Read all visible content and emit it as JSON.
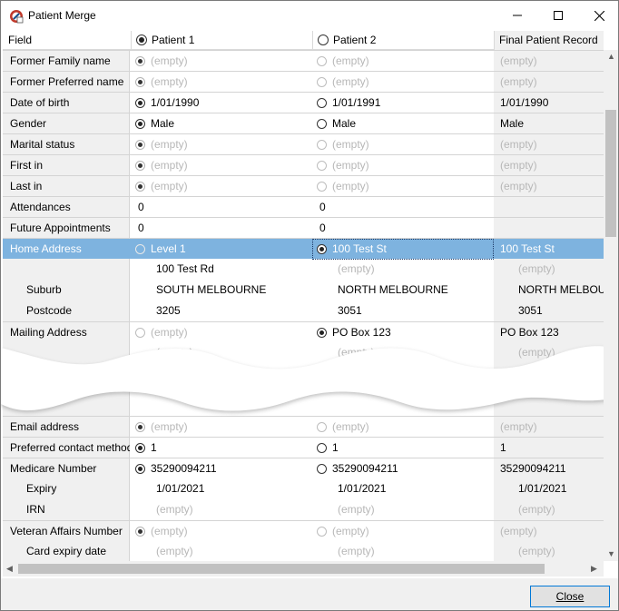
{
  "window": {
    "title": "Patient Merge",
    "close_button": "Close"
  },
  "columns": {
    "field": "Field",
    "patient1": "Patient 1",
    "patient2": "Patient 2",
    "final": "Final Patient Record"
  },
  "header_selected": "patient1",
  "empty_text": "(empty)",
  "rows_top": [
    {
      "field": "Former Family name",
      "p1": "(empty)",
      "p2": "(empty)",
      "fin": "(empty)",
      "radio1": "on",
      "radio2": "off",
      "disabled": true
    },
    {
      "field": "Former Preferred name",
      "p1": "(empty)",
      "p2": "(empty)",
      "fin": "(empty)",
      "radio1": "on",
      "radio2": "off",
      "disabled": true
    },
    {
      "field": "Date of birth",
      "p1": "1/01/1990",
      "p2": "1/01/1991",
      "fin": "1/01/1990",
      "radio1": "on",
      "radio2": "off",
      "disabled": false
    },
    {
      "field": "Gender",
      "p1": "Male",
      "p2": "Male",
      "fin": "Male",
      "radio1": "on",
      "radio2": "off",
      "disabled": false
    },
    {
      "field": "Marital status",
      "p1": "(empty)",
      "p2": "(empty)",
      "fin": "(empty)",
      "radio1": "on",
      "radio2": "off",
      "disabled": true
    },
    {
      "field": "First in",
      "p1": "(empty)",
      "p2": "(empty)",
      "fin": "(empty)",
      "radio1": "on",
      "radio2": "off",
      "disabled": true
    },
    {
      "field": "Last in",
      "p1": "(empty)",
      "p2": "(empty)",
      "fin": "(empty)",
      "radio1": "on",
      "radio2": "off",
      "disabled": true
    },
    {
      "field": "Attendances",
      "p1": "0",
      "p2": "0",
      "fin": ""
    },
    {
      "field": "Future Appointments",
      "p1": "0",
      "p2": "0",
      "fin": ""
    }
  ],
  "home_address": {
    "field": "Home Address",
    "p1": "Level 1",
    "p2": "100 Test St",
    "fin": "100 Test St",
    "line2": {
      "p1": "100 Test Rd",
      "p2": "(empty)",
      "fin": "(empty)"
    },
    "suburb": {
      "field": "Suburb",
      "p1": "SOUTH MELBOURNE",
      "p2": "NORTH MELBOURNE",
      "fin": "NORTH MELBOURNE"
    },
    "postcode": {
      "field": "Postcode",
      "p1": "3205",
      "p2": "3051",
      "fin": "3051"
    }
  },
  "mailing_address": {
    "field": "Mailing Address",
    "p1": "(empty)",
    "p2": "PO Box 123",
    "fin": "PO Box 123",
    "line2": {
      "p1": "(empty)",
      "p2": "(empty)",
      "fin": "(empty)"
    }
  },
  "rows_bottom": [
    {
      "field": "Email address",
      "p1": "(empty)",
      "p2": "(empty)",
      "fin": "(empty)",
      "disabled": true
    },
    {
      "field": "Preferred contact method",
      "p1": "1",
      "p2": "1",
      "fin": "1",
      "disabled": false
    }
  ],
  "medicare": {
    "field": "Medicare Number",
    "p1": "35290094211",
    "p2": "35290094211",
    "fin": "35290094211",
    "expiry": {
      "field": "Expiry",
      "p1": "1/01/2021",
      "p2": "1/01/2021",
      "fin": "1/01/2021"
    },
    "irn": {
      "field": "IRN",
      "p1": "(empty)",
      "p2": "(empty)",
      "fin": "(empty)"
    }
  },
  "veteran": {
    "field": "Veteran Affairs Number",
    "p1": "(empty)",
    "p2": "(empty)",
    "fin": "(empty)",
    "card_expiry": {
      "field": "Card expiry date",
      "p1": "(empty)",
      "p2": "(empty)",
      "fin": "(empty)"
    }
  },
  "colors": {
    "selected_row": "#7eb3df",
    "field_column": "#f0f0f0",
    "empty_text": "#b7b7b7",
    "button_border": "#0078d7"
  }
}
